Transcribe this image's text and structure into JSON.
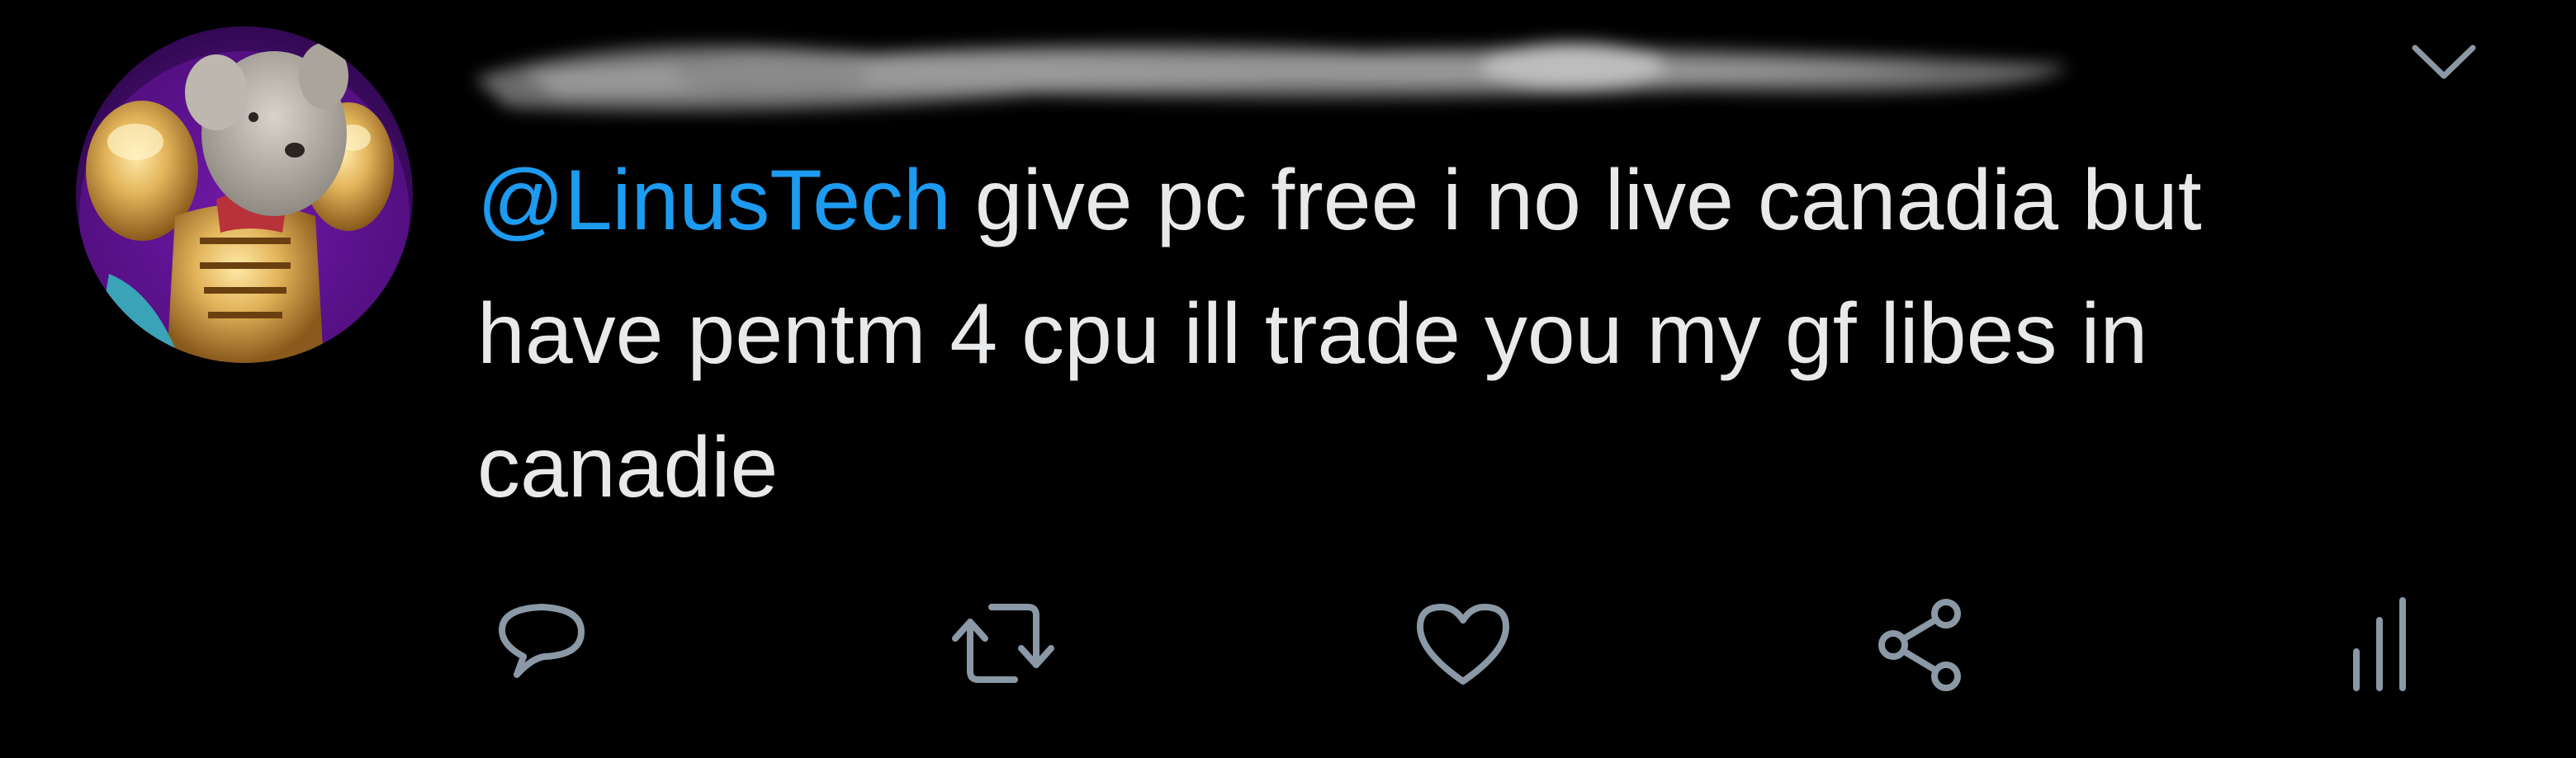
{
  "tweet": {
    "mention": "@LinusTech",
    "body_line_1": " give pc free i no live canadia but",
    "body_line_2": "have pentm 4 cpu ill trade you my gf libes in",
    "body_line_3": "canadie"
  },
  "actions": {
    "items": [
      {
        "name": "reply",
        "icon": "comment-icon"
      },
      {
        "name": "retweet",
        "icon": "retweet-icon"
      },
      {
        "name": "like",
        "icon": "heart-icon"
      },
      {
        "name": "share",
        "icon": "share-icon"
      },
      {
        "name": "analytics",
        "icon": "bar-chart-icon"
      }
    ]
  },
  "colors": {
    "background": "#000000",
    "text": "#e7e9ea",
    "mention": "#1d9bf0",
    "icon": "#8b98a5"
  }
}
